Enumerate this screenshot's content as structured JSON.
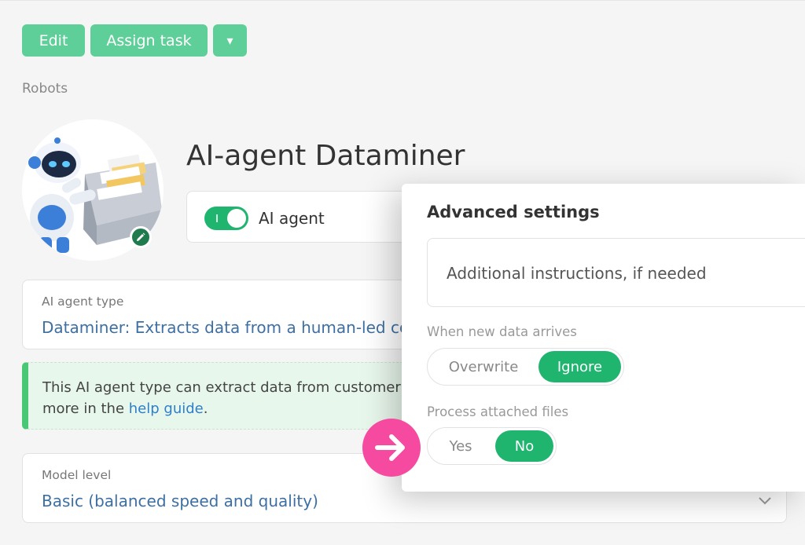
{
  "toolbar": {
    "edit_label": "Edit",
    "assign_label": "Assign task",
    "more_label": "▾"
  },
  "breadcrumb": "Robots",
  "agent": {
    "title": "AI-agent Dataminer",
    "toggle_label": "AI agent",
    "toggle_on": true
  },
  "agent_type": {
    "label": "AI agent type",
    "value": "Dataminer: Extracts data from a human-led conversation"
  },
  "info": {
    "text_line1": "This AI agent type can extract data from customer",
    "text_line2_prefix": "more in the",
    "link_text": "help guide",
    "text_suffix": "."
  },
  "model": {
    "label": "Model level",
    "value": "Basic (balanced speed and quality)"
  },
  "advanced": {
    "title": "Advanced settings",
    "instructions_placeholder": "Additional instructions, if needed",
    "new_data": {
      "label": "When new data arrives",
      "options": [
        "Overwrite",
        "Ignore"
      ],
      "selected": "Ignore"
    },
    "attached_files": {
      "label": "Process attached files",
      "options": [
        "Yes",
        "No"
      ],
      "selected": "No"
    }
  },
  "colors": {
    "accent": "#1fb56f",
    "button": "#5ecf98",
    "link": "#3d6fa3",
    "marker": "#f54aa0"
  }
}
